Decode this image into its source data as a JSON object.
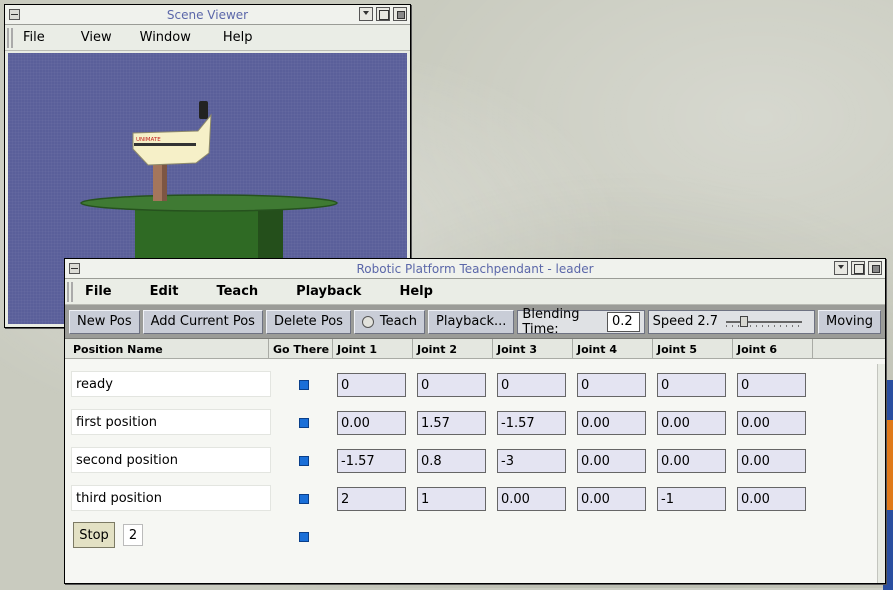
{
  "scene_viewer": {
    "title": "Scene Viewer",
    "menu": [
      "File",
      "View",
      "Window",
      "Help"
    ],
    "robot_logo_text": "UNIMATE"
  },
  "pendant": {
    "title": "Robotic Platform Teachpendant - leader",
    "menu": [
      "File",
      "Edit",
      "Teach",
      "Playback",
      "Help"
    ],
    "toolbar": {
      "new_pos": "New Pos",
      "add_current_pos": "Add Current Pos",
      "delete_pos": "Delete Pos",
      "teach": "Teach",
      "playback": "Playback...",
      "blending_label": "Blending Time:",
      "blending_value": "0.2",
      "speed_label": "Speed",
      "speed_value": "2.7",
      "moving": "Moving"
    },
    "headers": [
      "Position Name",
      "Go There",
      "Joint 1",
      "Joint 2",
      "Joint 3",
      "Joint 4",
      "Joint 5",
      "Joint 6"
    ],
    "rows": [
      {
        "name": "ready",
        "joints": [
          "0",
          "0",
          "0",
          "0",
          "0",
          "0"
        ]
      },
      {
        "name": "first position",
        "joints": [
          "0.00",
          "1.57",
          "-1.57",
          "0.00",
          "0.00",
          "0.00"
        ]
      },
      {
        "name": "second position",
        "joints": [
          "-1.57",
          "0.8",
          "-3",
          "0.00",
          "0.00",
          "0.00"
        ]
      },
      {
        "name": "third position",
        "joints": [
          "2",
          "1",
          "0.00",
          "0.00",
          "-1",
          "0.00"
        ]
      }
    ],
    "footer": {
      "stop": "Stop",
      "count": "2"
    }
  },
  "colors": {
    "title_text": "#5b67a9",
    "viewport_bg": "#5a5f9a",
    "go_there": "#1a6fd8",
    "joint_field": "#e4e4f2"
  }
}
